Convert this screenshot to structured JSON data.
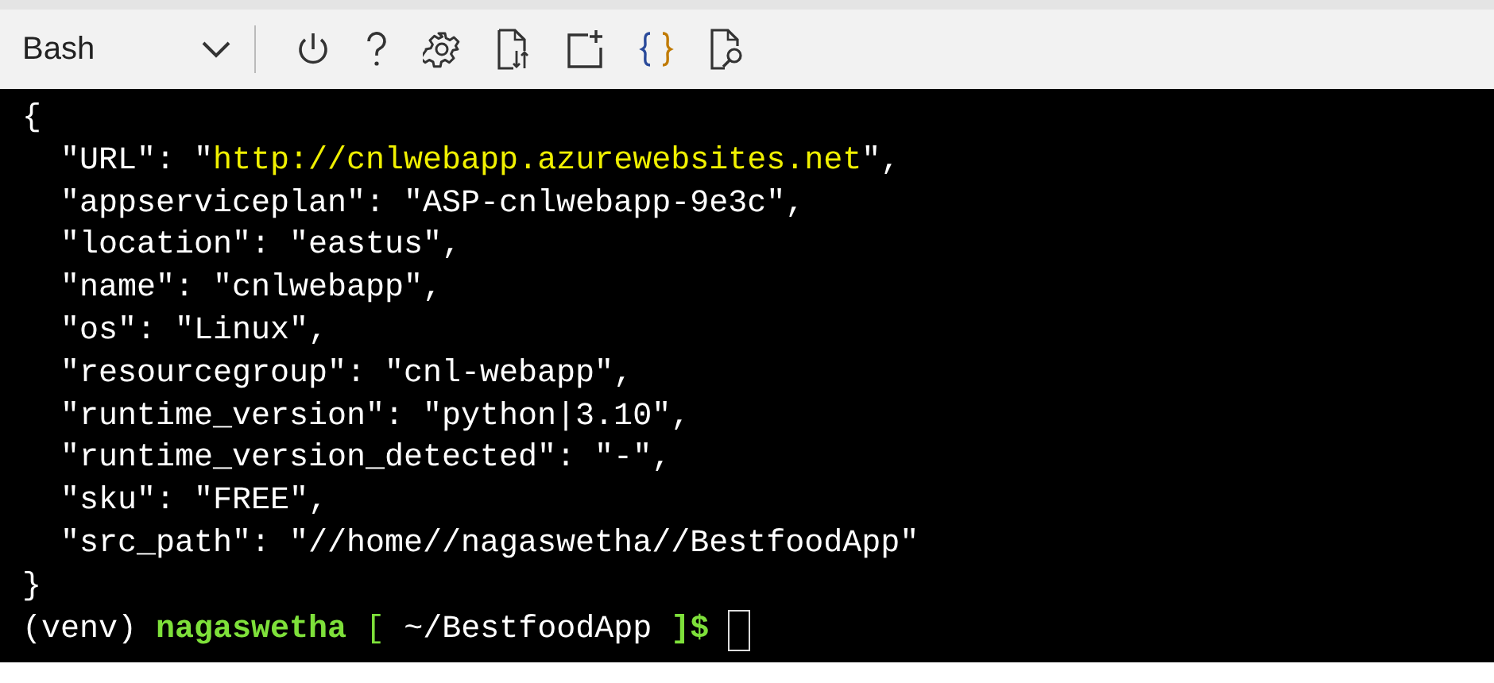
{
  "toolbar": {
    "shell_selector": {
      "value": "Bash"
    }
  },
  "terminal": {
    "lines": [
      [
        {
          "text": "{",
          "color": "#ffffff"
        }
      ],
      [
        {
          "text": "  \"URL\": \"",
          "color": "#ffffff"
        },
        {
          "text": "http://cnlwebapp.azurewebsites.net",
          "color": "#f0f000"
        },
        {
          "text": "\",",
          "color": "#ffffff"
        }
      ],
      [
        {
          "text": "  \"appserviceplan\": \"ASP-cnlwebapp-9e3c\",",
          "color": "#ffffff"
        }
      ],
      [
        {
          "text": "  \"location\": \"eastus\",",
          "color": "#ffffff"
        }
      ],
      [
        {
          "text": "  \"name\": \"cnlwebapp\",",
          "color": "#ffffff"
        }
      ],
      [
        {
          "text": "  \"os\": \"Linux\",",
          "color": "#ffffff"
        }
      ],
      [
        {
          "text": "  \"resourcegroup\": \"cnl-webapp\",",
          "color": "#ffffff"
        }
      ],
      [
        {
          "text": "  \"runtime_version\": \"python|3.10\",",
          "color": "#ffffff"
        }
      ],
      [
        {
          "text": "  \"runtime_version_detected\": \"-\",",
          "color": "#ffffff"
        }
      ],
      [
        {
          "text": "  \"sku\": \"FREE\",",
          "color": "#ffffff"
        }
      ],
      [
        {
          "text": "  \"src_path\": \"//home//nagaswetha//BestfoodApp\"",
          "color": "#ffffff"
        }
      ],
      [
        {
          "text": "}",
          "color": "#ffffff"
        }
      ]
    ],
    "prompt": [
      {
        "text": "(venv) ",
        "color": "#ffffff",
        "bold": false
      },
      {
        "text": "nagaswetha",
        "color": "#7ee03a",
        "bold": true
      },
      {
        "text": " [ ",
        "color": "#7ee03a",
        "bold": false
      },
      {
        "text": "~/BestfoodApp",
        "color": "#ffffff",
        "bold": false
      },
      {
        "text": " ]$",
        "color": "#7ee03a",
        "bold": true
      }
    ],
    "cursor": true
  }
}
